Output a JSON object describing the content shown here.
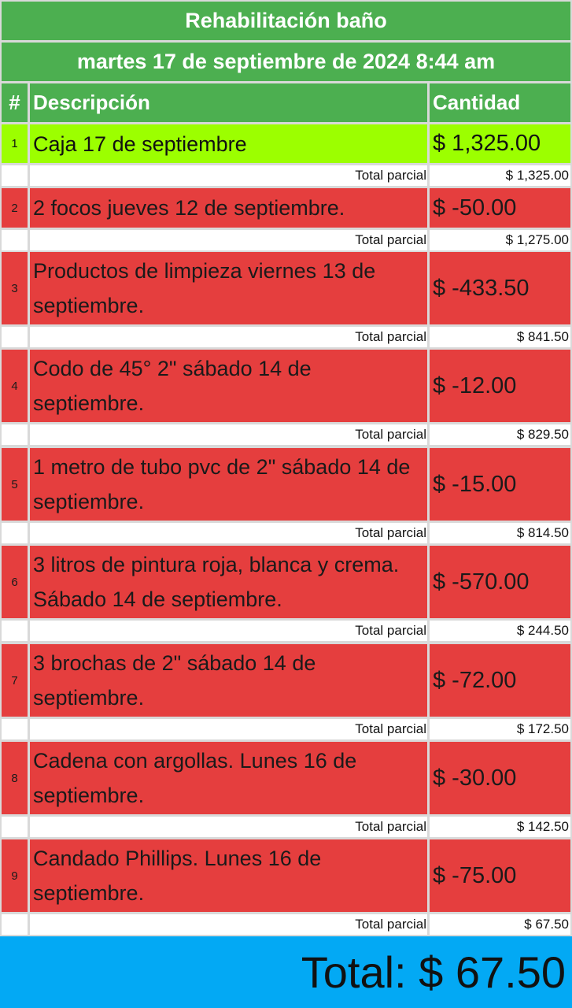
{
  "header": {
    "title": "Rehabilitación baño",
    "datetime": "martes 17 de septiembre de 2024 8:44 am"
  },
  "columns": {
    "num": "#",
    "description": "Descripción",
    "amount": "Cantidad"
  },
  "subtotal_label": "Total parcial",
  "colors": {
    "header_green": "#4caf50",
    "income_row": "#9cff00",
    "expense_row": "#e53e3e",
    "total_bar": "#03a9f4"
  },
  "rows": [
    {
      "num": "1",
      "description": "Caja 17 de septiembre",
      "amount": "$ 1,325.00",
      "subtotal": "$ 1,325.00",
      "kind": "income"
    },
    {
      "num": "2",
      "description": "2 focos jueves 12 de septiembre.",
      "amount": "$ -50.00",
      "subtotal": "$ 1,275.00",
      "kind": "expense"
    },
    {
      "num": "3",
      "description": "Productos de limpieza viernes 13 de septiembre.",
      "amount": "$ -433.50",
      "subtotal": "$ 841.50",
      "kind": "expense"
    },
    {
      "num": "4",
      "description": "Codo de 45° 2\" sábado 14 de septiembre.",
      "amount": "$ -12.00",
      "subtotal": "$ 829.50",
      "kind": "expense"
    },
    {
      "num": "5",
      "description": "1 metro de tubo pvc de 2\" sábado 14 de septiembre.",
      "amount": "$ -15.00",
      "subtotal": "$ 814.50",
      "kind": "expense"
    },
    {
      "num": "6",
      "description": "3 litros de pintura roja, blanca y crema. Sábado 14 de septiembre.",
      "amount": "$ -570.00",
      "subtotal": "$ 244.50",
      "kind": "expense"
    },
    {
      "num": "7",
      "description": "3 brochas de 2\" sábado 14 de septiembre.",
      "amount": "$ -72.00",
      "subtotal": "$ 172.50",
      "kind": "expense"
    },
    {
      "num": "8",
      "description": "Cadena con argollas. Lunes 16 de septiembre.",
      "amount": "$ -30.00",
      "subtotal": "$ 142.50",
      "kind": "expense"
    },
    {
      "num": "9",
      "description": "Candado Phillips. Lunes 16 de septiembre.",
      "amount": "$ -75.00",
      "subtotal": "$ 67.50",
      "kind": "expense"
    }
  ],
  "total": {
    "text": "Total: $ 67.50"
  }
}
